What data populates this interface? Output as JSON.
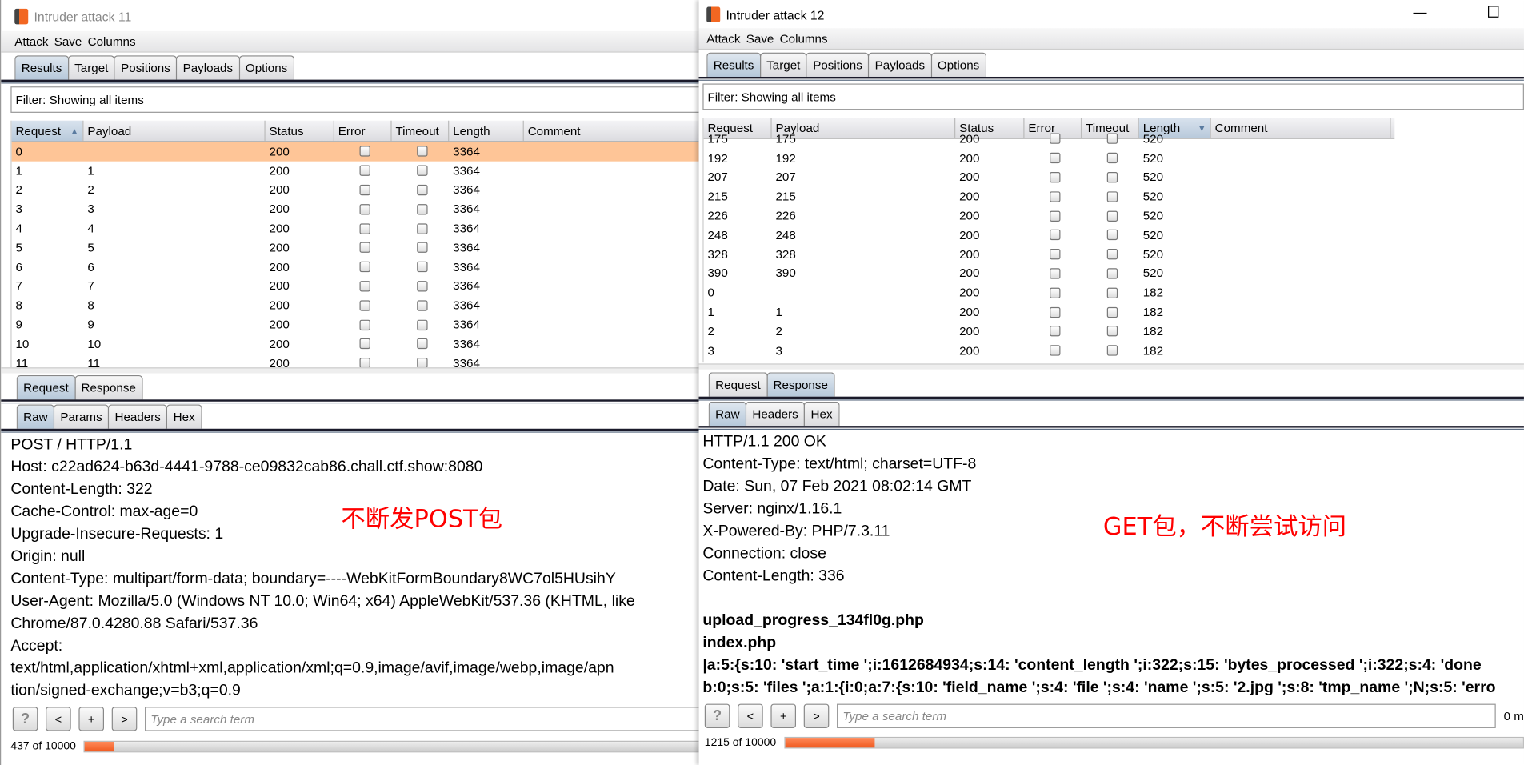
{
  "colors": {
    "accent": "#f26722",
    "selected_row": "#fec597",
    "annotation": "#ff0000"
  },
  "left": {
    "title": "Intruder attack 11",
    "menu": [
      "Attack",
      "Save",
      "Columns"
    ],
    "tabs": [
      "Results",
      "Target",
      "Positions",
      "Payloads",
      "Options"
    ],
    "active_tab": "Results",
    "filter": "Filter: Showing all items",
    "columns": [
      "Request",
      "Payload",
      "Status",
      "Error",
      "Timeout",
      "Length",
      "Comment"
    ],
    "sort": {
      "column": "Request",
      "direction": "ascending"
    },
    "rows": [
      [
        "0",
        "",
        "200",
        "3364"
      ],
      [
        "1",
        "1",
        "200",
        "3364"
      ],
      [
        "2",
        "2",
        "200",
        "3364"
      ],
      [
        "3",
        "3",
        "200",
        "3364"
      ],
      [
        "4",
        "4",
        "200",
        "3364"
      ],
      [
        "5",
        "5",
        "200",
        "3364"
      ],
      [
        "6",
        "6",
        "200",
        "3364"
      ],
      [
        "7",
        "7",
        "200",
        "3364"
      ],
      [
        "8",
        "8",
        "200",
        "3364"
      ],
      [
        "9",
        "9",
        "200",
        "3364"
      ],
      [
        "10",
        "10",
        "200",
        "3364"
      ],
      [
        "11",
        "11",
        "200",
        "3364"
      ]
    ],
    "selected_row": 0,
    "msg_tabs": [
      "Request",
      "Response"
    ],
    "msg_active": "Request",
    "view_tabs": [
      "Raw",
      "Params",
      "Headers",
      "Hex"
    ],
    "view_active": "Raw",
    "raw": [
      "POST / HTTP/1.1",
      "Host: c22ad624-b63d-4441-9788-ce09832cab86.chall.ctf.show:8080",
      "Content-Length: 322",
      "Cache-Control: max-age=0",
      "Upgrade-Insecure-Requests: 1",
      "Origin: null",
      "Content-Type: multipart/form-data; boundary=----WebKitFormBoundary8WC7ol5HUsihY",
      "User-Agent: Mozilla/5.0 (Windows NT 10.0; Win64; x64) AppleWebKit/537.36 (KHTML, like",
      "Chrome/87.0.4280.88 Safari/537.36",
      "Accept:",
      "text/html,application/xhtml+xml,application/xml;q=0.9,image/avif,image/webp,image/apn",
      "tion/signed-exchange;v=b3;q=0.9"
    ],
    "annotation": "不断发POST包",
    "search": {
      "buttons": [
        "?",
        "<",
        "+",
        ">"
      ],
      "placeholder": "Type a search term"
    },
    "progress": {
      "text": "437 of 10000",
      "done": 437,
      "total": 10000
    }
  },
  "right": {
    "title": "Intruder attack 12",
    "window_controls": [
      "minimize",
      "maximize"
    ],
    "menu": [
      "Attack",
      "Save",
      "Columns"
    ],
    "tabs": [
      "Results",
      "Target",
      "Positions",
      "Payloads",
      "Options"
    ],
    "active_tab": "Results",
    "filter": "Filter: Showing all items",
    "columns": [
      "Request",
      "Payload",
      "Status",
      "Error",
      "Timeout",
      "Length",
      "Comment"
    ],
    "sort": {
      "column": "Length",
      "direction": "descending"
    },
    "rows": [
      [
        "175",
        "175",
        "200",
        "520"
      ],
      [
        "192",
        "192",
        "200",
        "520"
      ],
      [
        "207",
        "207",
        "200",
        "520"
      ],
      [
        "215",
        "215",
        "200",
        "520"
      ],
      [
        "226",
        "226",
        "200",
        "520"
      ],
      [
        "248",
        "248",
        "200",
        "520"
      ],
      [
        "328",
        "328",
        "200",
        "520"
      ],
      [
        "390",
        "390",
        "200",
        "520"
      ],
      [
        "0",
        "",
        "200",
        "182"
      ],
      [
        "1",
        "1",
        "200",
        "182"
      ],
      [
        "2",
        "2",
        "200",
        "182"
      ],
      [
        "3",
        "3",
        "200",
        "182"
      ]
    ],
    "msg_tabs": [
      "Request",
      "Response"
    ],
    "msg_active": "Response",
    "view_tabs": [
      "Raw",
      "Headers",
      "Hex"
    ],
    "view_active": "Raw",
    "raw": [
      "HTTP/1.1 200 OK",
      "Content-Type: text/html; charset=UTF-8",
      "Date: Sun, 07 Feb 2021 08:02:14 GMT",
      "Server: nginx/1.16.1",
      "X-Powered-By: PHP/7.3.11",
      "Connection: close",
      "Content-Length: 336",
      ""
    ],
    "raw_bold": [
      "upload_progress_134fl0g.php",
      "index.php",
      "|a:5:{s:10: 'start_time ';i:1612684934;s:14: 'content_length ';i:322;s:15: 'bytes_processed ';i:322;s:4: 'done",
      "b:0;s:5: 'files ';a:1:{i:0;a:7:{s:10: 'field_name ';s:4: 'file ';s:4: 'name ';s:5: '2.jpg ';s:8: 'tmp_name ';N;s:5: 'erro"
    ],
    "annotation": "GET包，不断尝试访问",
    "search": {
      "buttons": [
        "?",
        "<",
        "+",
        ">"
      ],
      "placeholder": "Type a search term",
      "matches": "0 m"
    },
    "progress": {
      "text": "1215 of 10000",
      "done": 1215,
      "total": 10000
    }
  }
}
